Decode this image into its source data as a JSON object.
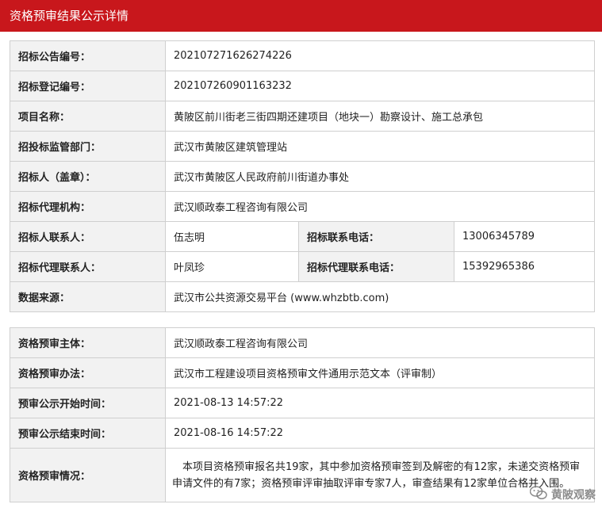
{
  "header": {
    "title": "资格预审结果公示详情"
  },
  "info_rows": [
    {
      "label": "招标公告编号：",
      "value": "202107271626274226"
    },
    {
      "label": "招标登记编号：",
      "value": "20210726090116323​2"
    },
    {
      "label": "项目名称：",
      "value": "黄陂区前川街老三街四期还建项目（地块一）勘察设计、施工总承包"
    },
    {
      "label": "招投标监管部门：",
      "value": "武汉市黄陂区建筑管理站"
    },
    {
      "label": "招标人（盖章）：",
      "value": "武汉市黄陂区人民政府前川街道办事处"
    },
    {
      "label": "招标代理机构：",
      "value": "武汉顺政泰工程咨询有限公司"
    }
  ],
  "contacts": [
    {
      "label": "招标人联系人：",
      "value": "伍志明",
      "phone_label": "招标联系电话：",
      "phone": "13006345789"
    },
    {
      "label": "招标代理联系人：",
      "value": "叶凤珍",
      "phone_label": "招标代理联系电话：",
      "phone": "15392965386"
    }
  ],
  "source": {
    "label": "数据来源：",
    "value": "武汉市公共资源交易平台 (www.whzbtb.com)"
  },
  "prequal_rows": [
    {
      "label": "资格预审主体：",
      "value": "武汉顺政泰工程咨询有限公司"
    },
    {
      "label": "资格预审办法：",
      "value": "武汉市工程建设项目资格预审文件通用示范文本（评审制）"
    },
    {
      "label": "预审公示开始时间：",
      "value": "2021-08-13 14:57:22"
    },
    {
      "label": "预审公示结束时间：",
      "value": "2021-08-16 14:57:22"
    }
  ],
  "situation": {
    "label": "资格预审情况：",
    "value": "本项目资格预审报名共19家，其中参加资格预审签到及解密的有12家，未递交资格预审申请文件的有7家；资格预审评审抽取评审专家7人，审查结果有12家单位合格并入围。"
  },
  "watermark": {
    "text": "黄陂观察",
    "icon": "wechat-icon"
  }
}
